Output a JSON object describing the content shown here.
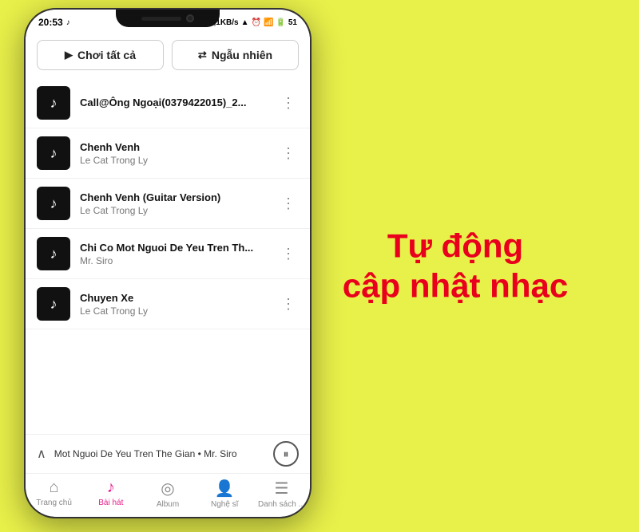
{
  "background_color": "#e8f04a",
  "right_text": {
    "line1": "Tự động",
    "line2": "cập nhật nhạc"
  },
  "phone": {
    "status_bar": {
      "time": "20:53",
      "note_icon": "♪",
      "info": "0,1KB/s",
      "battery": "51"
    },
    "action_buttons": {
      "play_all_label": "Chơi tất cả",
      "shuffle_label": "Ngẫu nhiên"
    },
    "songs": [
      {
        "title": "Call@Ông Ngoại(0379422015)_2...",
        "artist": "<unknown>"
      },
      {
        "title": "Chenh Venh",
        "artist": "Le Cat Trong Ly"
      },
      {
        "title": "Chenh Venh (Guitar Version)",
        "artist": "Le Cat Trong Ly"
      },
      {
        "title": "Chi Co Mot Nguoi De Yeu Tren Th...",
        "artist": "Mr. Siro"
      },
      {
        "title": "Chuyen Xe",
        "artist": "Le Cat Trong Ly"
      }
    ],
    "mini_player": {
      "track": "Mot Nguoi De Yeu Tren The Gian",
      "artist": "Mr. Siro"
    },
    "nav_items": [
      {
        "label": "Trang chủ",
        "icon": "⌂",
        "active": false
      },
      {
        "label": "Bài hát",
        "icon": "♪",
        "active": true
      },
      {
        "label": "Album",
        "icon": "◎",
        "active": false
      },
      {
        "label": "Nghệ sĩ",
        "icon": "👤",
        "active": false
      },
      {
        "label": "Danh sách ...",
        "icon": "☰",
        "active": false
      }
    ]
  }
}
